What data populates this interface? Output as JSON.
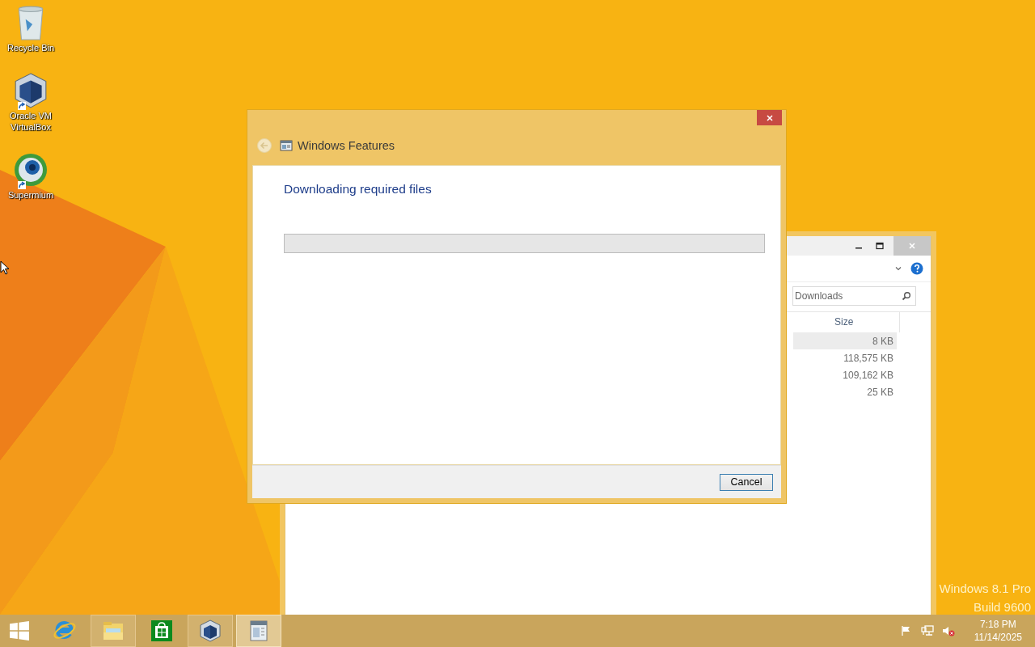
{
  "desktop": {
    "icons": [
      {
        "kind": "recycle",
        "label": "Recycle Bin"
      },
      {
        "kind": "vbox",
        "label": "Oracle VM VirtualBox"
      },
      {
        "kind": "browser",
        "label": "Supermium"
      }
    ],
    "edition": [
      "Windows 8.1 Pro",
      "Build 9600"
    ]
  },
  "background_window": {
    "search": {
      "placeholder": "Downloads"
    },
    "columns": [
      "Size"
    ],
    "rows": [
      {
        "size": "8 KB",
        "selected": true
      },
      {
        "size": "118,575 KB",
        "selected": false
      },
      {
        "size": "109,162 KB",
        "selected": false
      },
      {
        "size": "25 KB",
        "selected": false
      }
    ]
  },
  "dialog": {
    "title": "Windows Features",
    "heading": "Downloading required files",
    "progress": {
      "level": 0
    },
    "buttons": [
      "Cancel"
    ]
  },
  "taskbar": {
    "items": [
      {
        "kind": "start",
        "running": false,
        "selected": false
      },
      {
        "kind": "ie",
        "running": false,
        "selected": false
      },
      {
        "kind": "explorer",
        "running": true,
        "selected": false
      },
      {
        "kind": "store",
        "running": false,
        "selected": false
      },
      {
        "kind": "vbox",
        "running": true,
        "selected": false
      },
      {
        "kind": "features",
        "running": true,
        "selected": true
      }
    ],
    "time": "7:18 PM",
    "date": "11/14/2025"
  }
}
